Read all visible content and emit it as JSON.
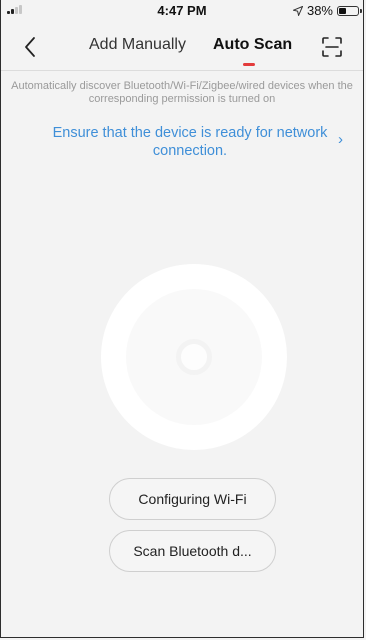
{
  "status_bar": {
    "time": "4:47 PM",
    "battery_text": "38%",
    "battery_level": 0.38,
    "signal_bars": 2,
    "location_icon": "location-arrow-icon"
  },
  "header": {
    "back_icon": "chevron-left-icon",
    "tab_manual": "Add Manually",
    "tab_auto": "Auto Scan",
    "active_tab": "Auto Scan",
    "scan_icon": "scan-frame-icon"
  },
  "content": {
    "hint": "Automatically discover Bluetooth/Wi-Fi/Zigbee/wired devices when the corresponding permission is turned on",
    "ready_link": "Ensure that the device is ready for network connection.",
    "ready_chevron": "›"
  },
  "buttons": {
    "wifi_label": "Configuring Wi-Fi",
    "bluetooth_label": "Scan Bluetooth d..."
  },
  "colors": {
    "accent_blue": "#3f8fd8",
    "indicator_red": "#e33b3b",
    "background": "#f3f3f3"
  }
}
